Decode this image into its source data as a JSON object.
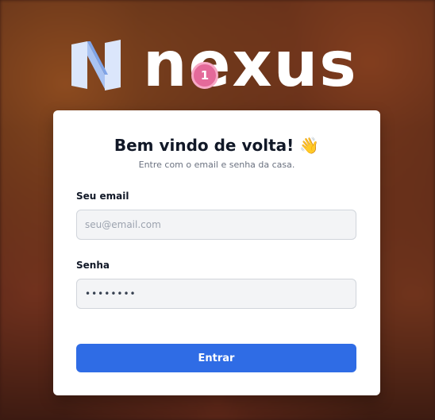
{
  "brand": {
    "name": "nexus",
    "logo_icon": "nexus-logo-icon"
  },
  "step_badge": "1",
  "login": {
    "title": "Bem vindo de volta!",
    "wave_emoji": "👋",
    "subtitle": "Entre com o email e senha da casa.",
    "email_label": "Seu email",
    "email_placeholder": "seu@email.com",
    "password_label": "Senha",
    "password_value": "••••••••",
    "submit_label": "Entrar"
  },
  "colors": {
    "primary": "#2f6ce5",
    "badge": "#e46a9a"
  }
}
